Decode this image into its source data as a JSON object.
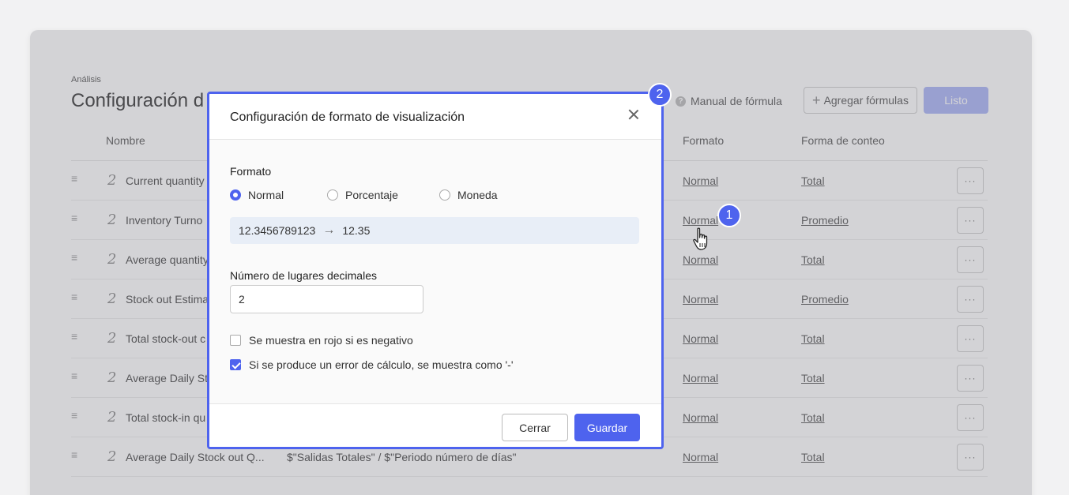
{
  "page": {
    "breadcrumb": "Análisis",
    "title": "Configuración d",
    "manual_label": "Manual de fórmula",
    "add_label": "Agregar fórmulas",
    "done_label": "Listo"
  },
  "table": {
    "headers": {
      "name": "Nombre",
      "format": "Formato",
      "count": "Forma de conteo"
    },
    "rows": [
      {
        "name": "Current quantity",
        "formula": "",
        "format": "Normal",
        "count": "Total"
      },
      {
        "name": "Inventory Turno",
        "formula": "",
        "format": "Normal",
        "count": "Promedio"
      },
      {
        "name": "Average quantity",
        "formula": "",
        "format": "Normal",
        "count": "Total"
      },
      {
        "name": "Stock out Estima",
        "formula": "",
        "format": "Normal",
        "count": "Promedio"
      },
      {
        "name": "Total stock-out c",
        "formula": "",
        "format": "Normal",
        "count": "Total"
      },
      {
        "name": "Average Daily Sto",
        "formula": "",
        "format": "Normal",
        "count": "Total"
      },
      {
        "name": "Total stock-in qu",
        "formula": "",
        "format": "Normal",
        "count": "Total"
      },
      {
        "name": "Average Daily Stock out Q...",
        "formula": "$\"Salidas Totales\" / $\"Periodo número de días\"",
        "format": "Normal",
        "count": "Total"
      }
    ]
  },
  "modal": {
    "title": "Configuración de formato de visualización",
    "format_label": "Formato",
    "options": [
      "Normal",
      "Porcentaje",
      "Moneda"
    ],
    "selected_option": "Normal",
    "preview_input": "12.3456789123",
    "preview_output": "12.35",
    "decimals_label": "Número de lugares decimales",
    "decimals_value": "2",
    "check_negative_label": "Se muestra en rojo si es negativo",
    "check_negative": false,
    "check_error_label": "Si se produce un error de cálculo, se muestra como '-'",
    "check_error": true,
    "cancel_label": "Cerrar",
    "save_label": "Guardar"
  },
  "badges": {
    "one": "1",
    "two": "2"
  },
  "colors": {
    "accent": "#4e63ee",
    "done_disabled": "#a9b3f6",
    "preview_bg": "#e8eef7"
  },
  "icons": [
    "close-icon",
    "help-icon",
    "plus-icon",
    "drag-handle-icon",
    "formula-icon",
    "more-icon",
    "hand-cursor-icon"
  ]
}
